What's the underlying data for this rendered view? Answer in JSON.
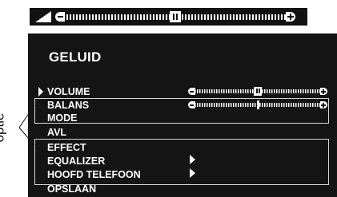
{
  "volume_bar": {
    "icon": "volume-wedge-icon",
    "level": 0.5
  },
  "menu": {
    "title": "GELUID",
    "items": [
      {
        "label": "VOLUME",
        "selected": true
      },
      {
        "label": "BALANS"
      },
      {
        "label": "MODE"
      },
      {
        "label": "AVL"
      },
      {
        "label": "EFFECT"
      },
      {
        "label": "EQUALIZER",
        "submenu": true
      },
      {
        "label": "HOOFD TELEFOON",
        "submenu": true
      },
      {
        "label": "OPSLAAN"
      }
    ],
    "volume_slider_level": 0.5,
    "balance_slider_level": 0.5
  },
  "annotation": {
    "side_label": "optie"
  },
  "colors": {
    "panel": "#141414",
    "text": "#ffffff",
    "box_border": "#d8d8d8"
  }
}
